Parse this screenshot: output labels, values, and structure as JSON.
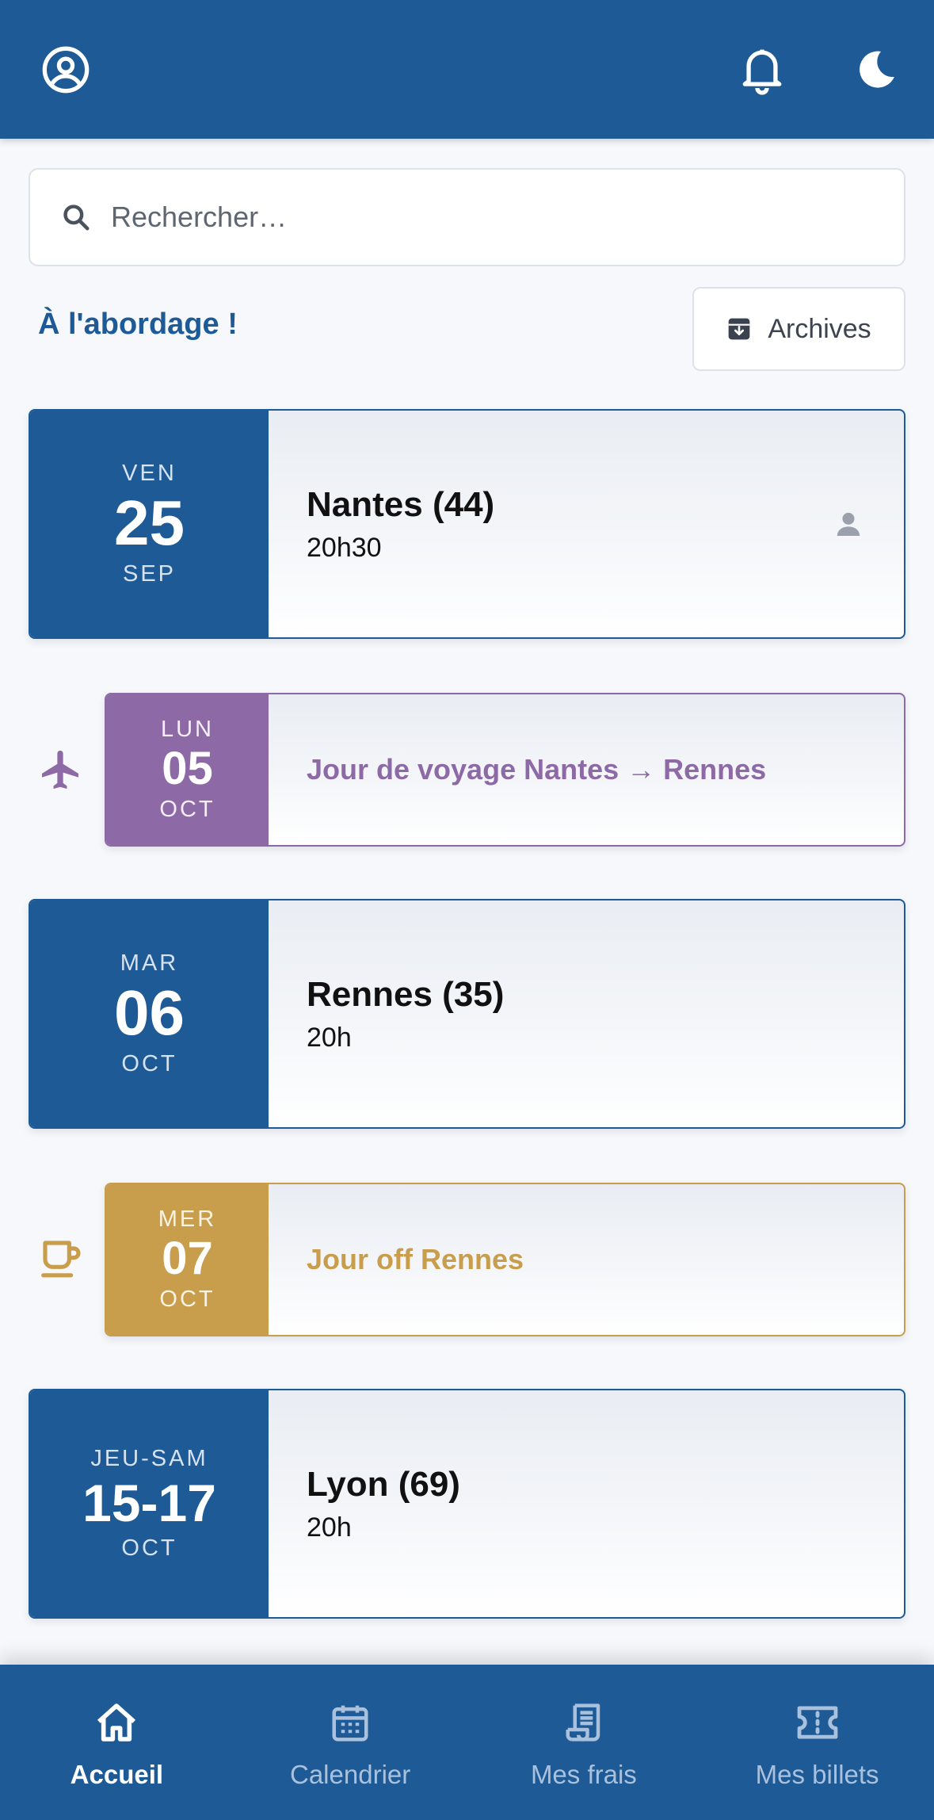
{
  "header": {
    "icons": [
      "user-circle-icon",
      "bell-icon",
      "moon-icon"
    ]
  },
  "search": {
    "placeholder": "Rechercher…"
  },
  "section": {
    "title": "À l'abordage !",
    "archives_label": "Archives"
  },
  "events": [
    {
      "type": "concert",
      "dow": "VEN",
      "day": "25",
      "month": "SEP",
      "city": "Nantes (44)",
      "time": "20h30",
      "icon": "person-icon"
    },
    {
      "type": "travel",
      "dow": "LUN",
      "day": "05",
      "month": "OCT",
      "title": "Jour de voyage Nantes → Rennes",
      "icon": "airplane-icon"
    },
    {
      "type": "concert",
      "dow": "MAR",
      "day": "06",
      "month": "OCT",
      "city": "Rennes (35)",
      "time": "20h"
    },
    {
      "type": "off",
      "dow": "MER",
      "day": "07",
      "month": "OCT",
      "title": "Jour off Rennes",
      "icon": "coffee-cup-icon"
    },
    {
      "type": "concert",
      "dow": "JEU-SAM",
      "day": "15-17",
      "month": "OCT",
      "city": "Lyon (69)",
      "time": "20h"
    }
  ],
  "bottom_nav": {
    "items": [
      {
        "label": "Accueil",
        "icon": "home-icon",
        "active": true
      },
      {
        "label": "Calendrier",
        "icon": "calendar-icon",
        "active": false
      },
      {
        "label": "Mes frais",
        "icon": "receipt-icon",
        "active": false
      },
      {
        "label": "Mes billets",
        "icon": "ticket-icon",
        "active": false
      }
    ]
  },
  "colors": {
    "primary": "#1d5a96",
    "travel": "#8d6aa6",
    "off": "#c89d4c",
    "background": "#f6f8fb"
  }
}
